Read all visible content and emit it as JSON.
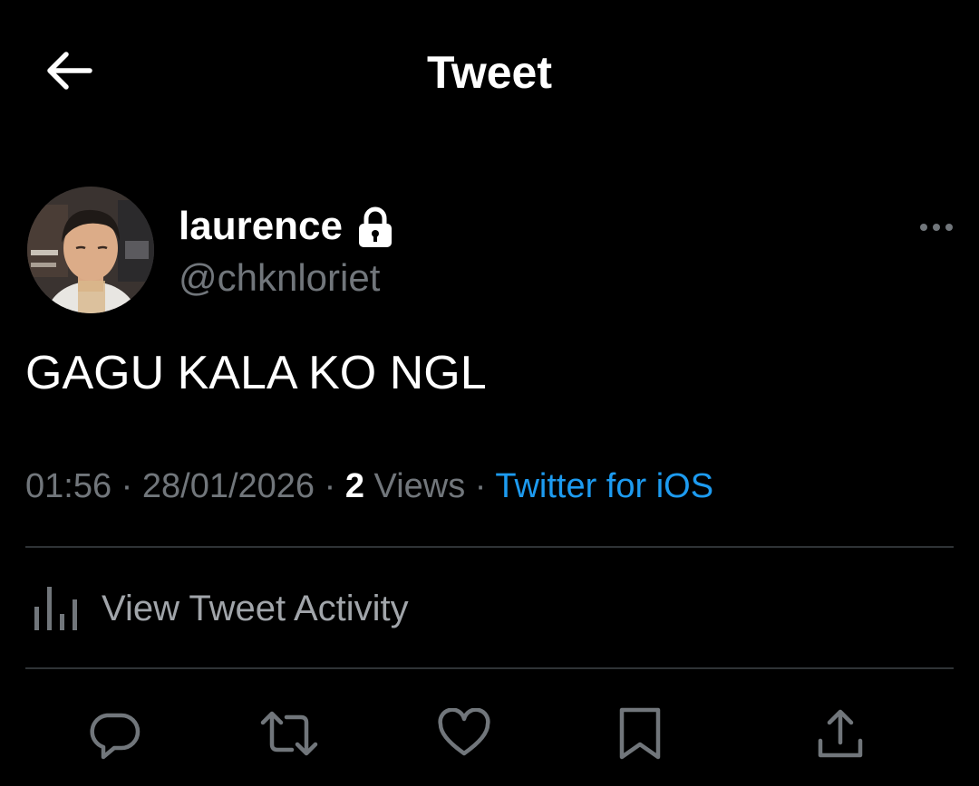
{
  "header": {
    "title": "Tweet",
    "back_icon": "arrow-left-icon"
  },
  "author": {
    "display_name": "laurence",
    "handle": "@chknloriet",
    "protected_icon": "lock-icon",
    "avatar_icon": "avatar-photo"
  },
  "tweet": {
    "text": "GAGU KALA KO NGL",
    "time": "01:56",
    "date": "28/01/2026",
    "separator": "·",
    "views_count": "2",
    "views_label": "Views",
    "source": "Twitter for iOS"
  },
  "activity": {
    "label": "View Tweet Activity",
    "icon": "bar-chart-icon"
  },
  "actions": [
    {
      "icon": "reply-icon"
    },
    {
      "icon": "retweet-icon"
    },
    {
      "icon": "like-icon"
    },
    {
      "icon": "bookmark-icon"
    },
    {
      "icon": "share-icon"
    }
  ],
  "colors": {
    "background": "#000000",
    "text": "#ffffff",
    "secondary": "#71767b",
    "link": "#1d9bf0",
    "divider": "#2f3336"
  }
}
